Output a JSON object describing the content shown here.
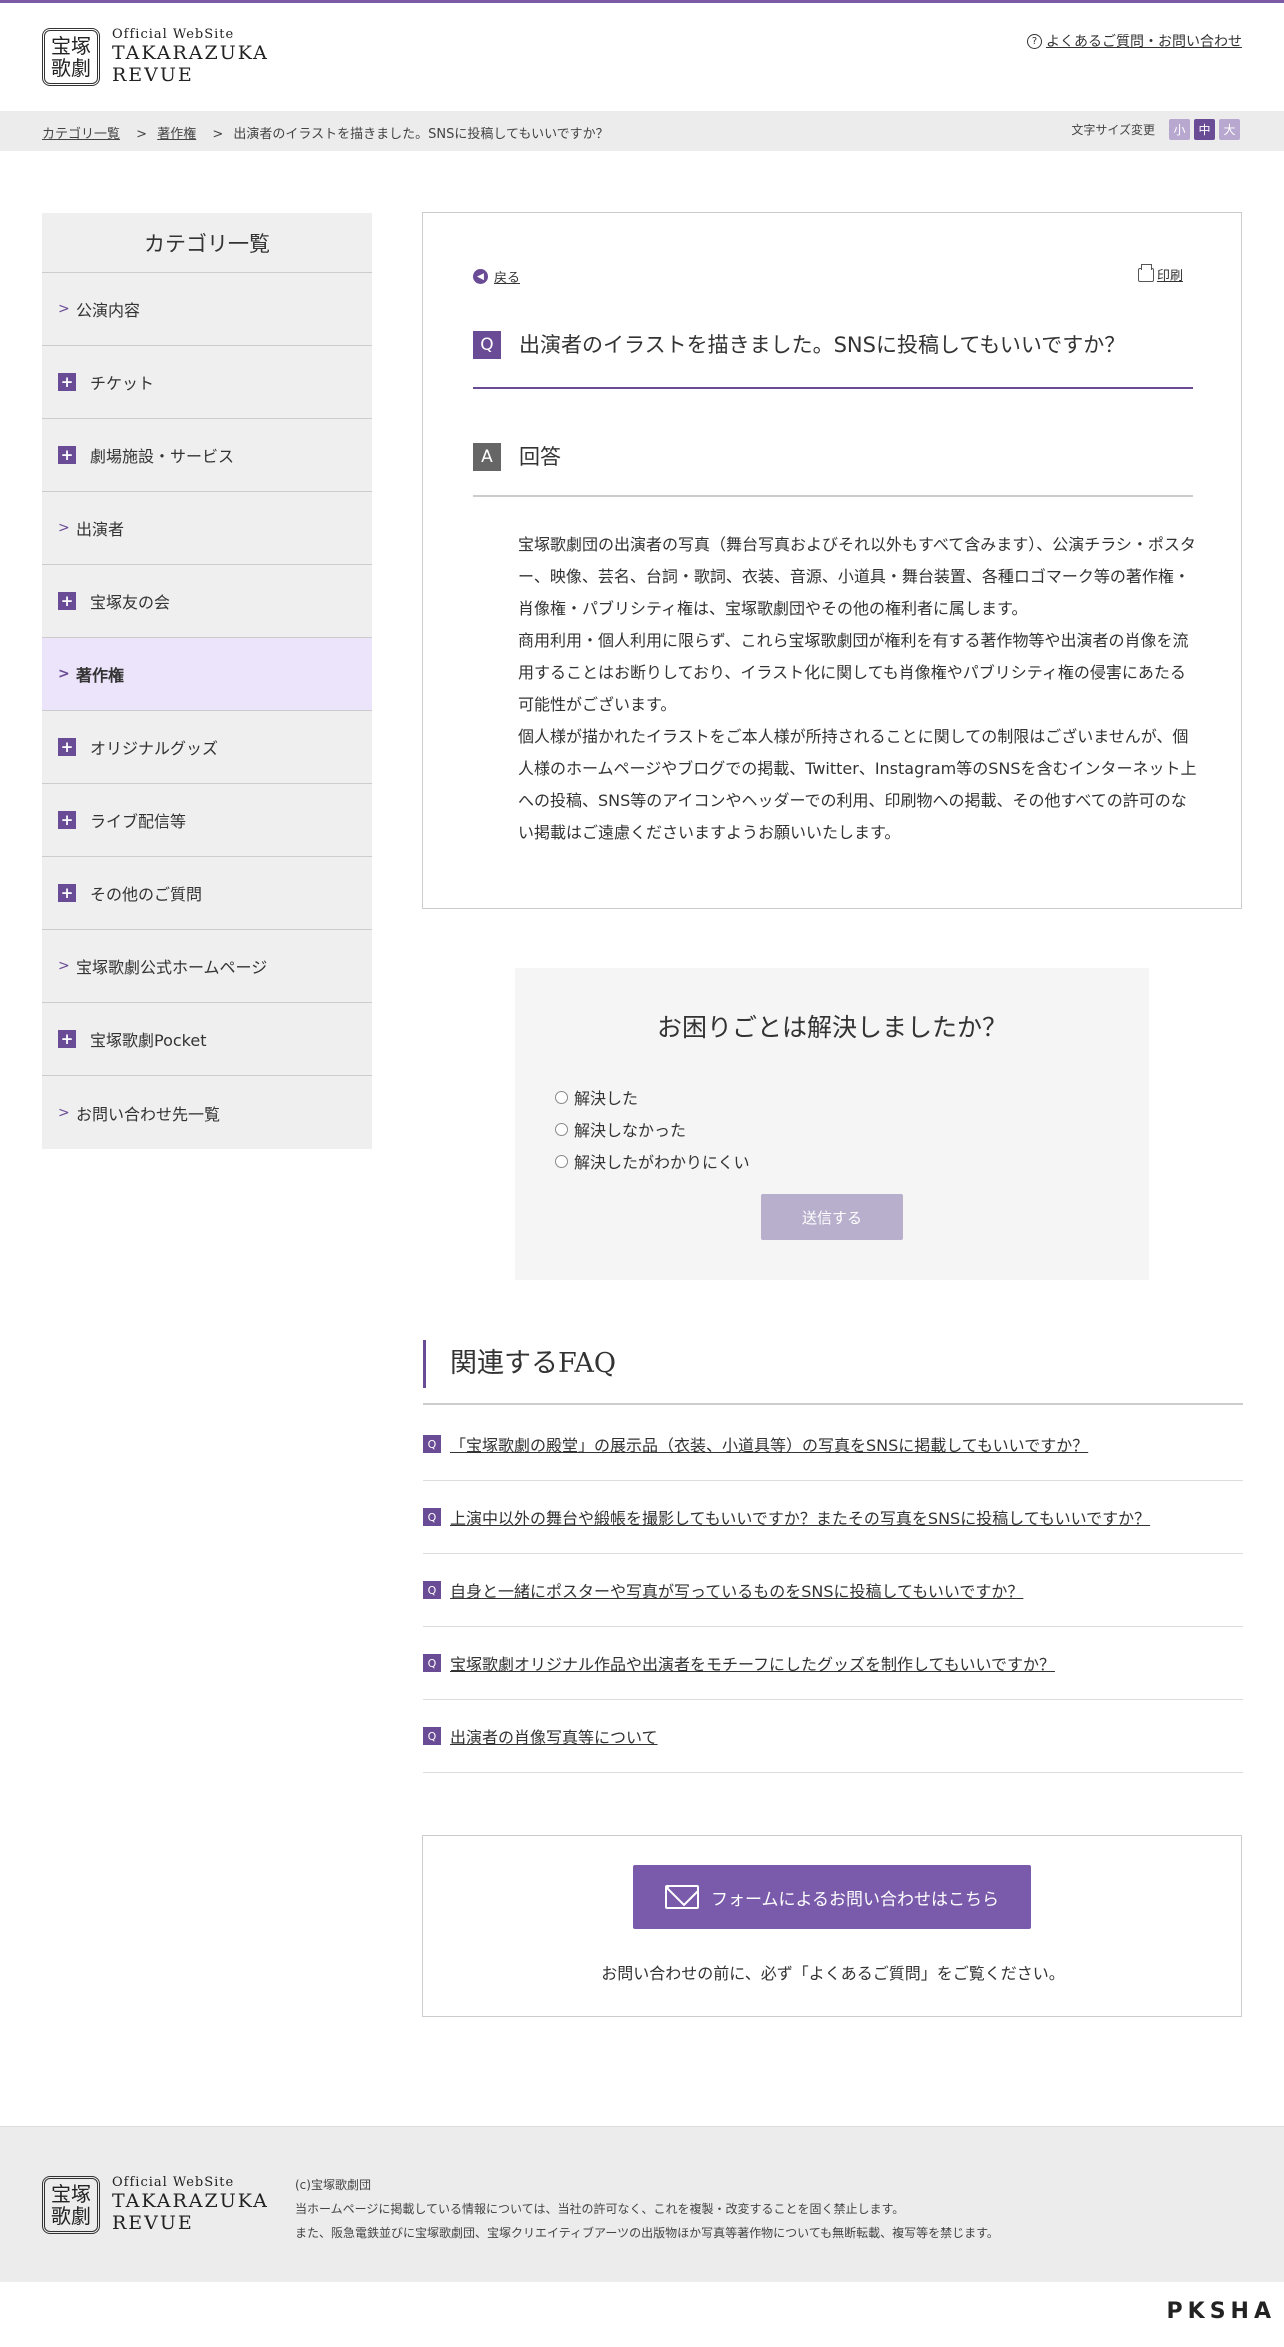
{
  "header": {
    "logo_seal": "宝塚歌劇",
    "logo_small": "Official WebSite",
    "logo_line1": "TAKARAZUKA",
    "logo_line2": "REVUE",
    "faq_link": "よくあるご質問・お問い合わせ"
  },
  "breadcrumb": {
    "items": [
      "カテゴリ一覧",
      "著作権",
      "出演者のイラストを描きました。SNSに投稿してもいいですか？"
    ],
    "separator": ">"
  },
  "font_size": {
    "label": "文字サイズ変更",
    "small": "小",
    "medium": "中",
    "large": "大",
    "selected": "中"
  },
  "sidebar": {
    "title": "カテゴリ一覧",
    "items": [
      {
        "label": "公演内容",
        "icon": "chevron-icon"
      },
      {
        "label": "チケット",
        "icon": "plus-icon"
      },
      {
        "label": "劇場施設・サービス",
        "icon": "plus-icon"
      },
      {
        "label": "出演者",
        "icon": "chevron-icon"
      },
      {
        "label": "宝塚友の会",
        "icon": "plus-icon"
      },
      {
        "label": "著作権",
        "icon": "chevron-icon",
        "active": true
      },
      {
        "label": "オリジナルグッズ",
        "icon": "plus-icon"
      },
      {
        "label": "ライブ配信等",
        "icon": "plus-icon"
      },
      {
        "label": "その他のご質問",
        "icon": "plus-icon"
      },
      {
        "label": "宝塚歌劇公式ホームページ",
        "icon": "chevron-icon"
      },
      {
        "label": "宝塚歌劇Pocket",
        "icon": "plus-icon"
      },
      {
        "label": "お問い合わせ先一覧",
        "icon": "chevron-icon"
      }
    ]
  },
  "answer": {
    "back": "戻る",
    "print": "印刷",
    "q_badge": "Q",
    "question": "出演者のイラストを描きました。SNSに投稿してもいいですか？",
    "a_badge": "A",
    "answer_heading": "回答",
    "paragraphs": [
      "宝塚歌劇団の出演者の写真（舞台写真およびそれ以外もすべて含みます）、公演チラシ・ポスター、映像、芸名、台詞・歌詞、衣装、音源、小道具・舞台装置、各種ロゴマーク等の著作権・肖像権・パブリシティ権は、宝塚歌劇団やその他の権利者に属します。",
      "商用利用・個人利用に限らず、これら宝塚歌劇団が権利を有する著作物等や出演者の肖像を流用することはお断りしており、イラスト化に関しても肖像権やパブリシティ権の侵害にあたる可能性がございます。",
      "個人様が描かれたイラストをご本人様が所持されることに関しての制限はございませんが、個人様のホームページやブログでの掲載、Twitter、Instagram等のSNSを含むインターネット上への投稿、SNS等のアイコンやヘッダーでの利用、印刷物への掲載、その他すべての許可のない掲載はご遠慮くださいますようお願いいたします。"
    ]
  },
  "survey": {
    "title": "お困りごとは解決しましたか？",
    "options": [
      "解決した",
      "解決しなかった",
      "解決したがわかりにくい"
    ],
    "submit": "送信する"
  },
  "related": {
    "title": "関連するFAQ",
    "badge": "Q",
    "items": [
      "「宝塚歌劇の殿堂」の展示品（衣装、小道具等）の写真をSNSに掲載してもいいですか？",
      "上演中以外の舞台や緞帳を撮影してもいいですか？またその写真をSNSに投稿してもいいですか？",
      "自身と一緒にポスターや写真が写っているものをSNSに投稿してもいいですか？",
      "宝塚歌劇オリジナル作品や出演者をモチーフにしたグッズを制作してもいいですか？",
      "出演者の肖像写真等について"
    ]
  },
  "contact": {
    "button": "フォームによるお問い合わせはこちら",
    "note": "お問い合わせの前に、必ず「よくあるご質問」をご覧ください。"
  },
  "footer": {
    "copyright": "(c)宝塚歌劇団",
    "line1": "当ホームページに掲載している情報については、当社の許可なく、これを複製・改変することを固く禁止します。",
    "line2": "また、阪急電鉄並びに宝塚歌劇団、宝塚クリエイティブアーツの出版物ほか写真等著作物についても無断転載、複写等を禁じます。",
    "brand": "PKSHA"
  },
  "colors": {
    "accent": "#6a4b96",
    "active_bg": "#ece4fa",
    "sidebar_bg": "#efefef",
    "submit_disabled": "#b8afcc"
  }
}
